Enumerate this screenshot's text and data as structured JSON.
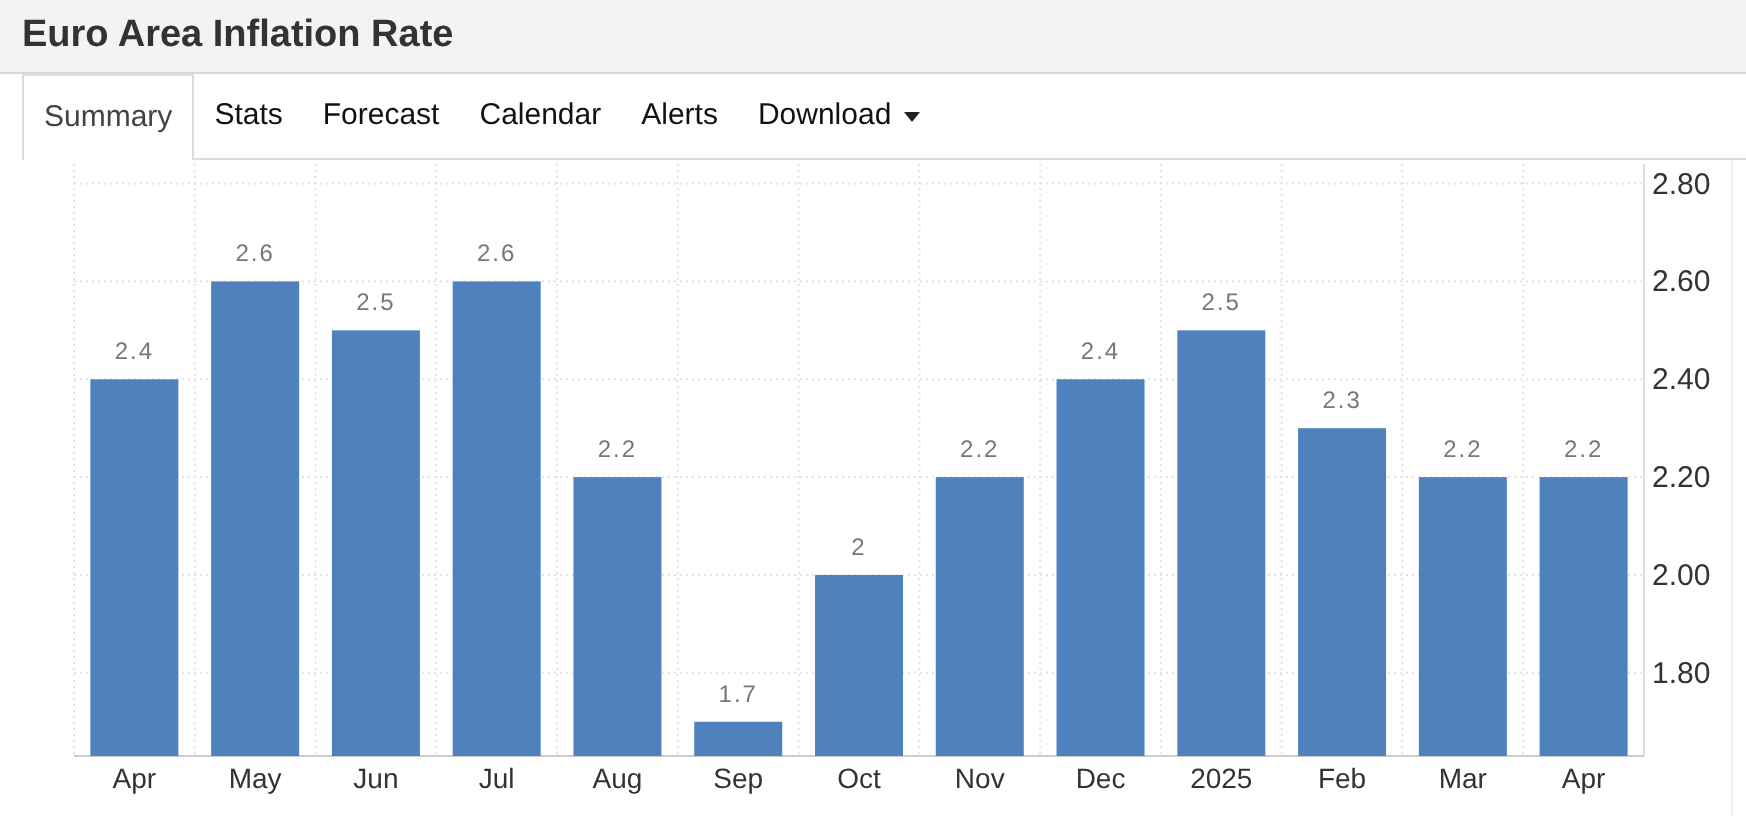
{
  "header": {
    "title": "Euro Area Inflation Rate"
  },
  "tabs": [
    {
      "label": "Summary",
      "selected": true,
      "dropdown": false
    },
    {
      "label": "Stats",
      "selected": false,
      "dropdown": false
    },
    {
      "label": "Forecast",
      "selected": false,
      "dropdown": false
    },
    {
      "label": "Calendar",
      "selected": false,
      "dropdown": false
    },
    {
      "label": "Alerts",
      "selected": false,
      "dropdown": false
    },
    {
      "label": "Download",
      "selected": false,
      "dropdown": true
    }
  ],
  "chart": {
    "chart_data": {
      "type": "bar",
      "categories": [
        "Apr",
        "May",
        "Jun",
        "Jul",
        "Aug",
        "Sep",
        "Oct",
        "Nov",
        "Dec",
        "2025",
        "Feb",
        "Mar",
        "Apr"
      ],
      "grid": true,
      "series": [
        {
          "color": "#4f81bd",
          "values": [
            2.4,
            2.6,
            2.5,
            2.6,
            2.2,
            1.7,
            2,
            2.2,
            2.4,
            2.5,
            2.3,
            2.2,
            2.2
          ]
        }
      ],
      "value_labels": [
        "2.4",
        "2.6",
        "2.5",
        "2.6",
        "2.2",
        "1.7",
        "2",
        "2.2",
        "2.4",
        "2.5",
        "2.3",
        "2.2",
        "2.2"
      ],
      "ylim": [
        1.63,
        2.84
      ],
      "yticks": [
        {
          "value": 1.8,
          "label": "1.80"
        },
        {
          "value": 2,
          "label": "2.00"
        },
        {
          "value": 2.2,
          "label": "2.20"
        },
        {
          "value": 2.4,
          "label": "2.40"
        },
        {
          "value": 2.6,
          "label": "2.60"
        },
        {
          "value": 2.8,
          "label": "2.80"
        }
      ]
    }
  }
}
